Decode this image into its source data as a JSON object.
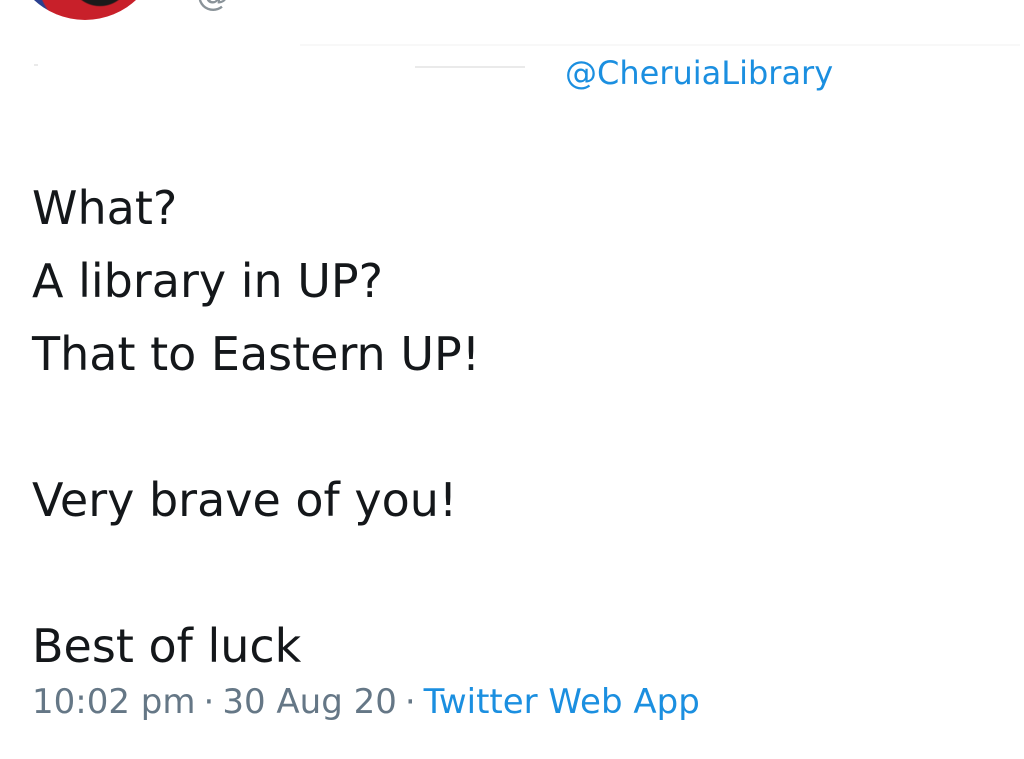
{
  "header": {
    "handle_cropped": "@"
  },
  "reply_to": "@CheruiaLibrary",
  "tweet": {
    "lines": [
      "What?",
      "A library in UP?",
      "That to Eastern UP!",
      "",
      "Very brave of you!",
      "",
      "Best of luck"
    ]
  },
  "meta": {
    "time": "10:02 pm",
    "separator": "·",
    "date": "30 Aug 20",
    "source": "Twitter Web App"
  },
  "colors": {
    "link": "#1b8fe0",
    "text": "#14171a",
    "muted": "#657786"
  }
}
